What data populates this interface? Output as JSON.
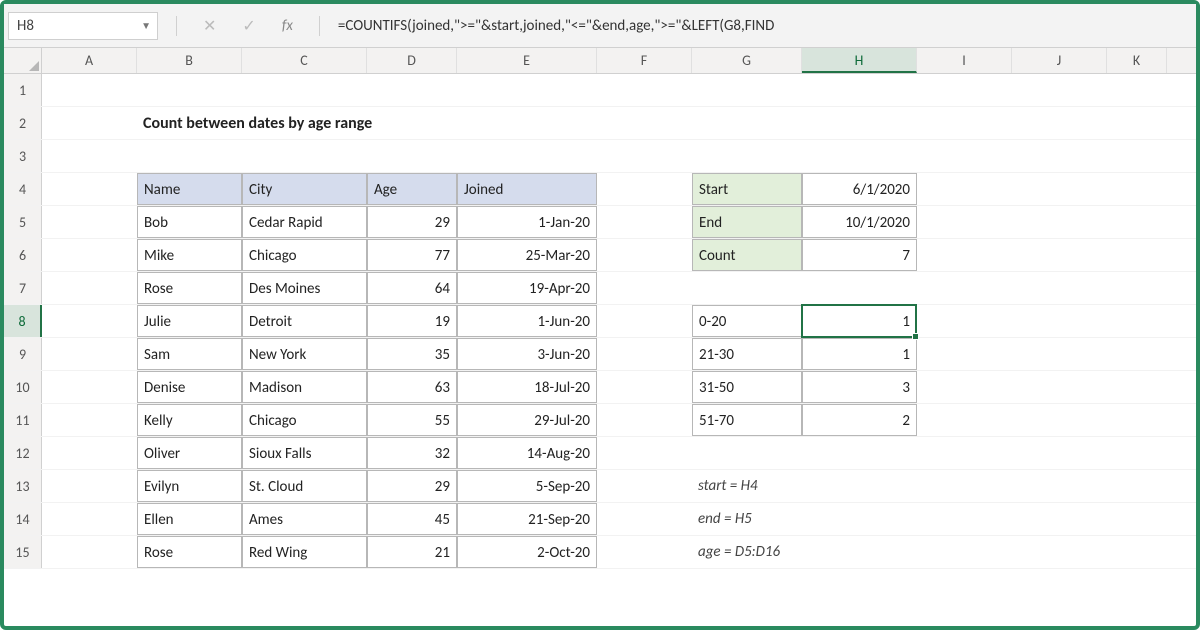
{
  "name_box": "H8",
  "formula": "=COUNTIFS(joined,\">=\"&start,joined,\"<=\"&end,age,\">=\"&LEFT(G8,FIND",
  "title": "Count between dates by age range",
  "columns": [
    "A",
    "B",
    "C",
    "D",
    "E",
    "F",
    "G",
    "H",
    "I",
    "J",
    "K"
  ],
  "row_count": 15,
  "active_col": "H",
  "active_row": 8,
  "table": {
    "headers": {
      "B": "Name",
      "C": "City",
      "D": "Age",
      "E": "Joined"
    },
    "rows": [
      {
        "B": "Bob",
        "C": "Cedar Rapid",
        "D": "29",
        "E": "1-Jan-20"
      },
      {
        "B": "Mike",
        "C": "Chicago",
        "D": "77",
        "E": "25-Mar-20"
      },
      {
        "B": "Rose",
        "C": "Des Moines",
        "D": "64",
        "E": "19-Apr-20"
      },
      {
        "B": "Julie",
        "C": "Detroit",
        "D": "19",
        "E": "1-Jun-20"
      },
      {
        "B": "Sam",
        "C": "New York",
        "D": "35",
        "E": "3-Jun-20"
      },
      {
        "B": "Denise",
        "C": "Madison",
        "D": "63",
        "E": "18-Jul-20"
      },
      {
        "B": "Kelly",
        "C": "Chicago",
        "D": "55",
        "E": "29-Jul-20"
      },
      {
        "B": "Oliver",
        "C": "Sioux Falls",
        "D": "32",
        "E": "14-Aug-20"
      },
      {
        "B": "Evilyn",
        "C": "St. Cloud",
        "D": "29",
        "E": "5-Sep-20"
      },
      {
        "B": "Ellen",
        "C": "Ames",
        "D": "45",
        "E": "21-Sep-20"
      },
      {
        "B": "Rose",
        "C": "Red Wing",
        "D": "21",
        "E": "2-Oct-20"
      }
    ]
  },
  "summary": {
    "rows": [
      {
        "label": "Start",
        "value": "6/1/2020"
      },
      {
        "label": "End",
        "value": "10/1/2020"
      },
      {
        "label": "Count",
        "value": "7"
      }
    ]
  },
  "ranges": [
    {
      "label": "0-20",
      "value": "1"
    },
    {
      "label": "21-30",
      "value": "1"
    },
    {
      "label": "31-50",
      "value": "3"
    },
    {
      "label": "51-70",
      "value": "2"
    }
  ],
  "notes": [
    "start = H4",
    "end = H5",
    "age = D5:D16"
  ]
}
